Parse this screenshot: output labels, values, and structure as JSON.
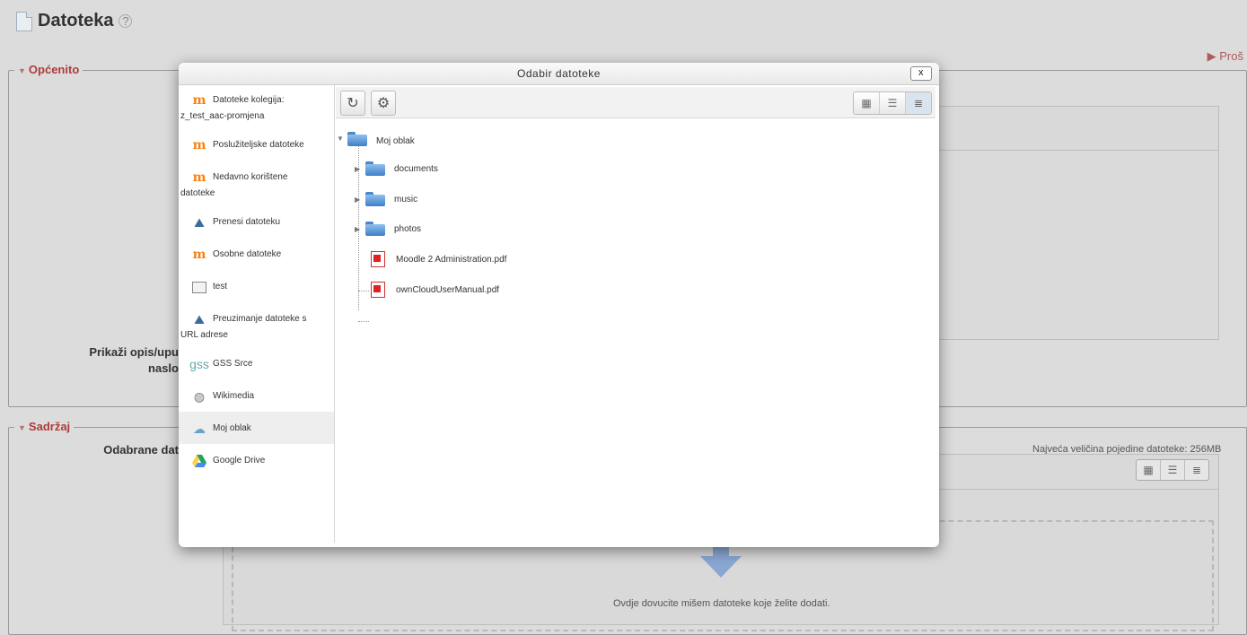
{
  "page": {
    "title": "Datoteka",
    "expand_link": "Proš",
    "section_general": "Općenito",
    "section_content": "Sadržaj",
    "show_description_label_l1": "Prikaži opis/upu",
    "show_description_label_l2": "naslo",
    "selected_files_label": "Odabrane dat",
    "max_size_text": "Najveća veličina pojedine datoteke: 256MB",
    "drop_text": "Ovdje dovucite mišem datoteke koje želite dodati."
  },
  "modal": {
    "title": "Odabir datoteke",
    "close_label": "x",
    "sidebar": [
      {
        "icon": "moodle-icon",
        "line1": "Datoteke kolegija:",
        "line2": "z_test_aac-promjena"
      },
      {
        "icon": "moodle-icon",
        "line1": "Poslužiteljske datoteke",
        "line2": ""
      },
      {
        "icon": "moodle-icon",
        "line1": "Nedavno korištene",
        "line2": "datoteke"
      },
      {
        "icon": "upload-icon",
        "line1": "Prenesi datoteku",
        "line2": ""
      },
      {
        "icon": "moodle-icon",
        "line1": "Osobne datoteke",
        "line2": ""
      },
      {
        "icon": "repository-icon",
        "line1": "test",
        "line2": ""
      },
      {
        "icon": "download-url-icon",
        "line1": "Preuzimanje datoteke s",
        "line2": "URL adrese"
      },
      {
        "icon": "gss-icon",
        "line1": "GSS Srce",
        "line2": ""
      },
      {
        "icon": "wikimedia-icon",
        "line1": "Wikimedia",
        "line2": ""
      },
      {
        "icon": "owncloud-icon",
        "line1": "Moj oblak",
        "line2": "",
        "active": true
      },
      {
        "icon": "google-drive-icon",
        "line1": "Google Drive",
        "line2": ""
      }
    ],
    "tree": {
      "root": "Moj oblak",
      "folders": [
        "documents",
        "music",
        "photos"
      ],
      "files": [
        "Moodle 2 Administration.pdf",
        "ownCloudUserManual.pdf"
      ]
    }
  }
}
